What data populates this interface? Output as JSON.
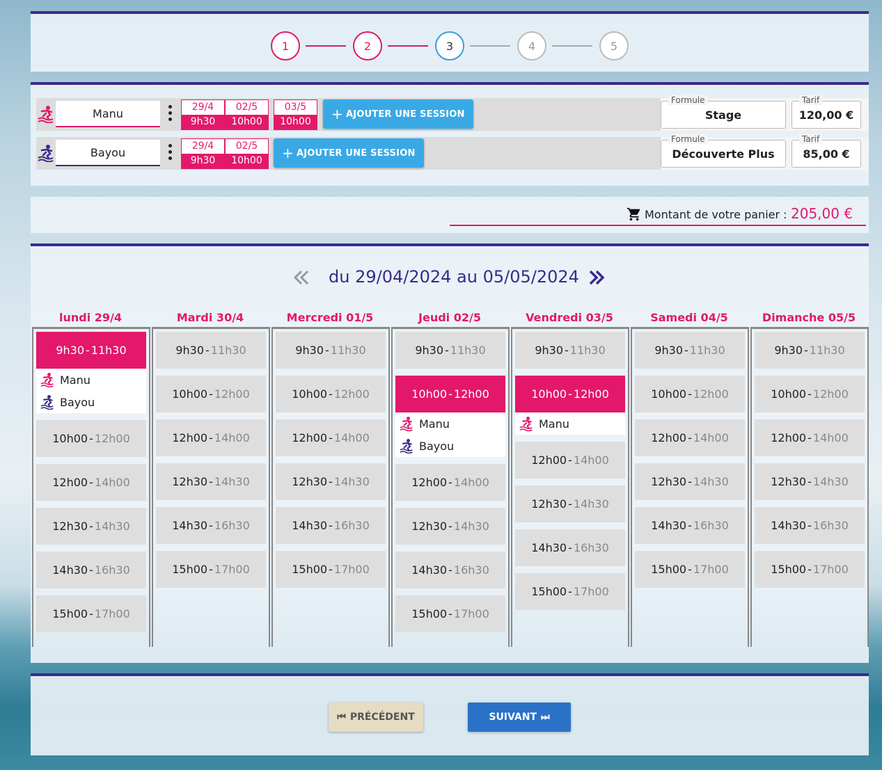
{
  "colors": {
    "accent": "#e3186a",
    "primary": "#3b2a8a",
    "info": "#39a9e6",
    "next": "#2a72c8",
    "prev": "#e6dcc3"
  },
  "stepper": {
    "steps": [
      "1",
      "2",
      "3",
      "4",
      "5"
    ],
    "current": 3
  },
  "participants": [
    {
      "name": "Manu",
      "icon": "surfer-icon",
      "sessions": [
        {
          "date": "29/4",
          "time": "9h30"
        },
        {
          "date": "02/5",
          "time": "10h00"
        },
        {
          "date": "03/5",
          "time": "10h00"
        }
      ],
      "add_label": "AJOUTER UNE SESSION",
      "formule_label": "Formule",
      "formule": "Stage",
      "tarif_label": "Tarif",
      "tarif": "120,00 €"
    },
    {
      "name": "Bayou",
      "icon": "surfer-icon",
      "sessions": [
        {
          "date": "29/4",
          "time": "9h30"
        },
        {
          "date": "02/5",
          "time": "10h00"
        }
      ],
      "add_label": "AJOUTER UNE SESSION",
      "formule_label": "Formule",
      "formule": "Découverte Plus",
      "tarif_label": "Tarif",
      "tarif": "85,00 €"
    }
  ],
  "cart": {
    "label": "Montant de votre panier :",
    "amount": "205,00 €"
  },
  "calendar": {
    "title": "du 29/04/2024 au 05/05/2024",
    "days": [
      {
        "label": "lundi 29/4",
        "slots": [
          {
            "start": "9h30",
            "end": "11h30",
            "selected": true,
            "people": [
              "Manu",
              "Bayou"
            ]
          },
          {
            "start": "10h00",
            "end": "12h00"
          },
          {
            "start": "12h00",
            "end": "14h00"
          },
          {
            "start": "12h30",
            "end": "14h30"
          },
          {
            "start": "14h30",
            "end": "16h30"
          },
          {
            "start": "15h00",
            "end": "17h00"
          }
        ]
      },
      {
        "label": "Mardi 30/4",
        "slots": [
          {
            "start": "9h30",
            "end": "11h30"
          },
          {
            "start": "10h00",
            "end": "12h00"
          },
          {
            "start": "12h00",
            "end": "14h00"
          },
          {
            "start": "12h30",
            "end": "14h30"
          },
          {
            "start": "14h30",
            "end": "16h30"
          },
          {
            "start": "15h00",
            "end": "17h00"
          }
        ]
      },
      {
        "label": "Mercredi 01/5",
        "slots": [
          {
            "start": "9h30",
            "end": "11h30"
          },
          {
            "start": "10h00",
            "end": "12h00"
          },
          {
            "start": "12h00",
            "end": "14h00"
          },
          {
            "start": "12h30",
            "end": "14h30"
          },
          {
            "start": "14h30",
            "end": "16h30"
          },
          {
            "start": "15h00",
            "end": "17h00"
          }
        ]
      },
      {
        "label": "Jeudi 02/5",
        "slots": [
          {
            "start": "9h30",
            "end": "11h30"
          },
          {
            "start": "10h00",
            "end": "12h00",
            "selected": true,
            "people": [
              "Manu",
              "Bayou"
            ]
          },
          {
            "start": "12h00",
            "end": "14h00"
          },
          {
            "start": "12h30",
            "end": "14h30"
          },
          {
            "start": "14h30",
            "end": "16h30"
          },
          {
            "start": "15h00",
            "end": "17h00"
          }
        ]
      },
      {
        "label": "Vendredi 03/5",
        "slots": [
          {
            "start": "9h30",
            "end": "11h30"
          },
          {
            "start": "10h00",
            "end": "12h00",
            "selected": true,
            "people": [
              "Manu"
            ]
          },
          {
            "start": "12h00",
            "end": "14h00"
          },
          {
            "start": "12h30",
            "end": "14h30"
          },
          {
            "start": "14h30",
            "end": "16h30"
          },
          {
            "start": "15h00",
            "end": "17h00"
          }
        ]
      },
      {
        "label": "Samedi 04/5",
        "slots": [
          {
            "start": "9h30",
            "end": "11h30"
          },
          {
            "start": "10h00",
            "end": "12h00"
          },
          {
            "start": "12h00",
            "end": "14h00"
          },
          {
            "start": "12h30",
            "end": "14h30"
          },
          {
            "start": "14h30",
            "end": "16h30"
          },
          {
            "start": "15h00",
            "end": "17h00"
          }
        ]
      },
      {
        "label": "Dimanche 05/5",
        "slots": [
          {
            "start": "9h30",
            "end": "11h30"
          },
          {
            "start": "10h00",
            "end": "12h00"
          },
          {
            "start": "12h00",
            "end": "14h00"
          },
          {
            "start": "12h30",
            "end": "14h30"
          },
          {
            "start": "14h30",
            "end": "16h30"
          },
          {
            "start": "15h00",
            "end": "17h00"
          }
        ]
      }
    ]
  },
  "nav": {
    "prev_label": "PRÉCÉDENT",
    "next_label": "SUIVANT"
  }
}
